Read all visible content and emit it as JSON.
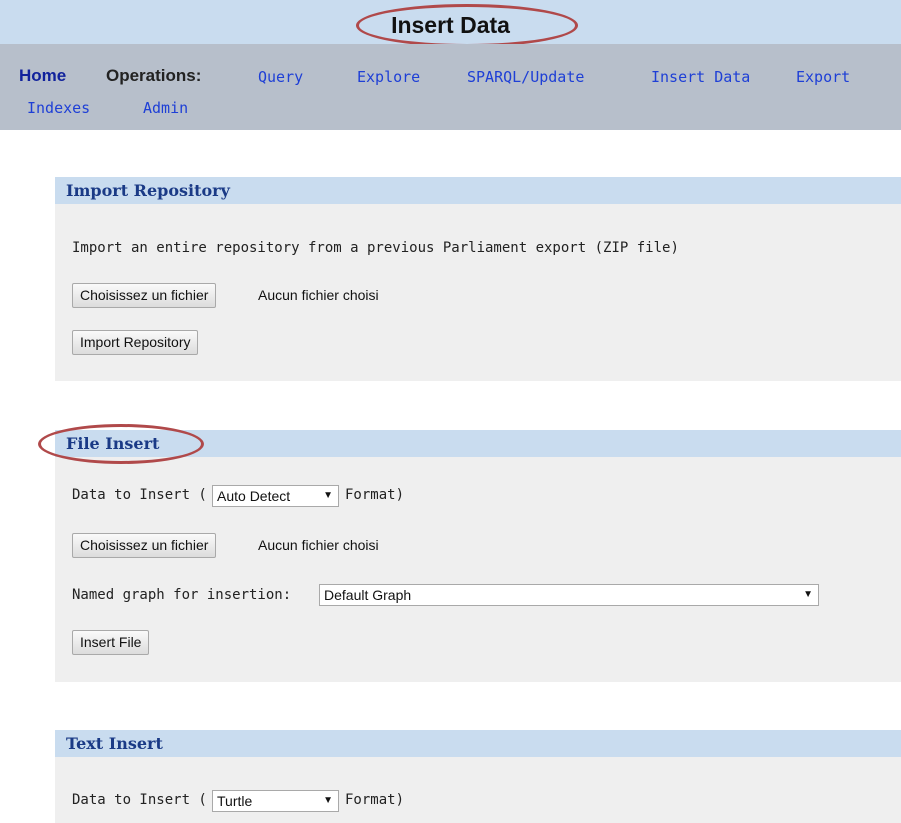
{
  "header": {
    "title": "Insert Data"
  },
  "nav": {
    "home": "Home",
    "operations_label": "Operations:",
    "items": [
      "Query",
      "Explore",
      "SPARQL/Update",
      "Insert Data",
      "Export",
      "Indexes",
      "Admin"
    ]
  },
  "import_repository": {
    "title": "Import Repository",
    "description": "Import an entire repository from a previous Parliament export (ZIP file)",
    "choose_file_button": "Choisissez un fichier",
    "no_file_text": "Aucun fichier choisi",
    "submit_button": "Import Repository"
  },
  "file_insert": {
    "title": "File Insert",
    "data_prefix": "Data to Insert (",
    "format_selected": "Auto Detect",
    "data_suffix": "Format)",
    "choose_file_button": "Choisissez un fichier",
    "no_file_text": "Aucun fichier choisi",
    "graph_label": "Named graph for insertion:",
    "graph_selected": "Default Graph",
    "submit_button": "Insert File"
  },
  "text_insert": {
    "title": "Text Insert",
    "data_prefix": "Data to Insert (",
    "format_selected": "Turtle",
    "data_suffix": "Format)"
  },
  "colors": {
    "header_bg": "#c9dcef",
    "nav_bg": "#b7bfcb",
    "link": "#1e3fd6",
    "section_title": "#1a3a86",
    "annotation_oval": "#b0494a"
  }
}
